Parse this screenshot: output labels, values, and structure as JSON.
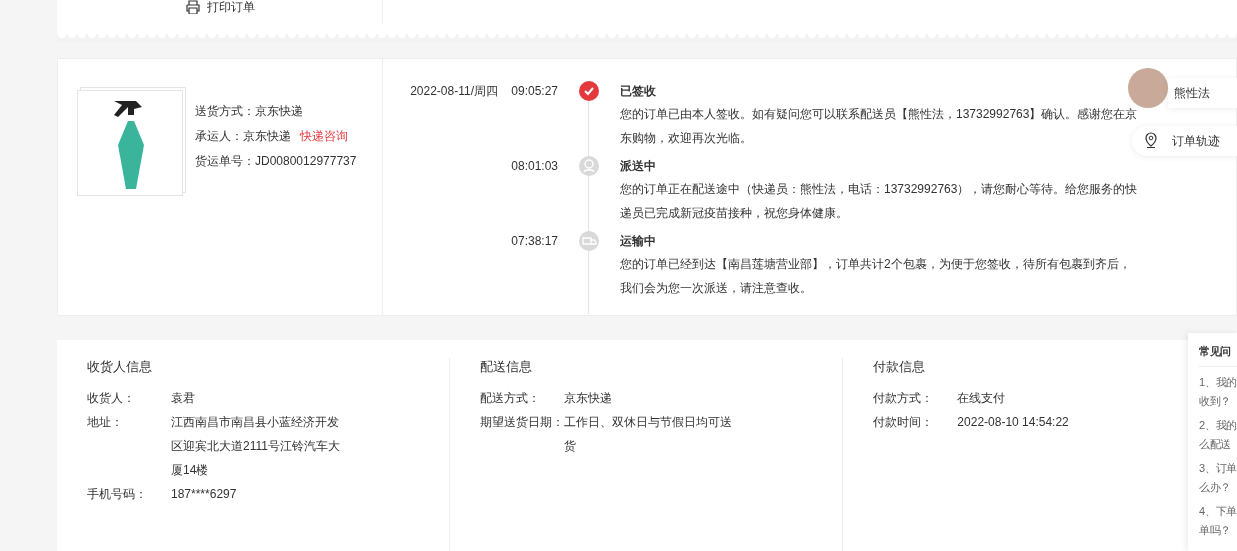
{
  "print_button": {
    "label": "打印订单"
  },
  "shipment": {
    "fields": [
      {
        "label": "送货方式：",
        "value": "京东快递"
      },
      {
        "label": "承运人：",
        "value": "京东快递",
        "link": "快递咨询"
      },
      {
        "label": "货运单号：",
        "value": "JD0080012977737"
      }
    ]
  },
  "tracking": {
    "date": "2022-08-11/周四",
    "events": [
      {
        "time": "09:05:27",
        "kind": "signed",
        "active": true,
        "title": "已签收",
        "description": "您的订单已由本人签收。如有疑问您可以联系配送员【熊性法，13732992763】确认。感谢您在京东购物，欢迎再次光临。"
      },
      {
        "time": "08:01:03",
        "kind": "delivering",
        "active": false,
        "title": "派送中",
        "description": "您的订单正在配送途中（快递员：熊性法，电话：13732992763），请您耐心等待。给您服务的快递员已完成新冠疫苗接种，祝您身体健康。"
      },
      {
        "time": "07:38:17",
        "kind": "transit",
        "active": false,
        "title": "运输中",
        "description": "您的订单已经到达【南昌莲塘营业部】，订单共计2个包裹，为便于您签收，待所有包裹到齐后，我们会为您一次派送，请注意查收。"
      }
    ]
  },
  "courier": {
    "name": "熊性法"
  },
  "track_button": {
    "label": "订单轨迹"
  },
  "info_sections": [
    {
      "title": "收货人信息",
      "fields": [
        {
          "label": "收货人：",
          "value": "袁君"
        },
        {
          "label": "地址：",
          "value": "江西南昌市南昌县小蓝经济开发区迎宾北大道2111号江铃汽车大厦14楼"
        },
        {
          "label": "手机号码：",
          "value": "187****6297"
        }
      ]
    },
    {
      "title": "配送信息",
      "fields": [
        {
          "label": "配送方式：",
          "value": "京东快递"
        },
        {
          "label": "期望送货日期：",
          "value": "工作日、双休日与节假日均可送货"
        }
      ]
    },
    {
      "title": "付款信息",
      "fields": [
        {
          "label": "付款方式：",
          "value": "在线支付"
        },
        {
          "label": "付款时间：",
          "value": "2022-08-10 14:54:22"
        }
      ]
    }
  ],
  "faq": {
    "title": "常见问",
    "items": [
      [
        "1、我的",
        "收到？"
      ],
      [
        "2、我的",
        "么配送"
      ],
      [
        "3、订单",
        "么办？"
      ],
      [
        "4、下单",
        "单吗？"
      ]
    ]
  }
}
